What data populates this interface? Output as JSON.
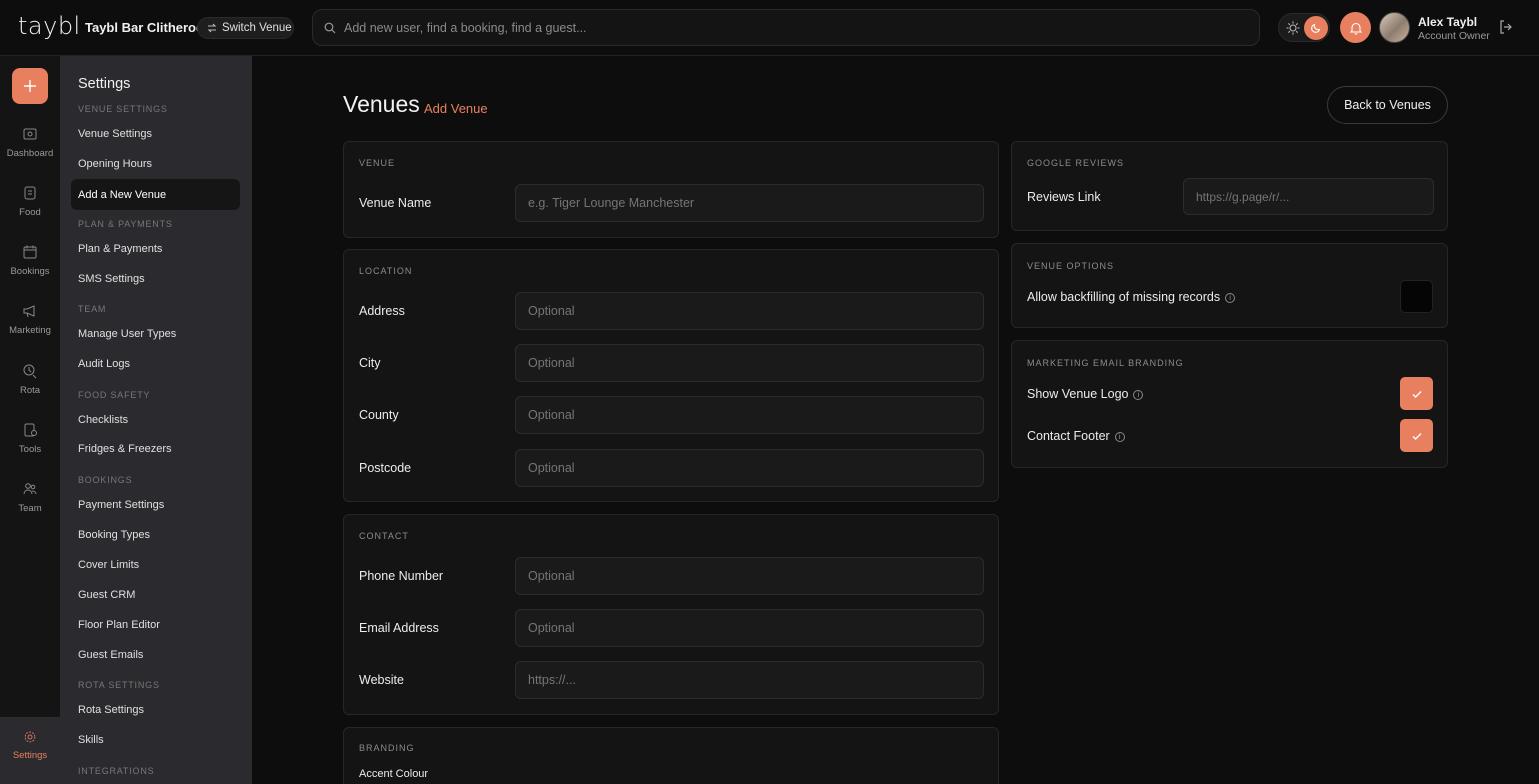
{
  "topbar": {
    "logo": "taybl",
    "venue_name": "Taybl Bar Clitheroe",
    "switch_venue": "Switch Venue",
    "search_placeholder": "Add new user, find a booking, find a guest...",
    "user_name": "Alex Taybl",
    "user_role": "Account Owner"
  },
  "rail": {
    "items": [
      {
        "label": "Dashboard",
        "icon": "dashboard-icon"
      },
      {
        "label": "Food",
        "icon": "food-icon"
      },
      {
        "label": "Bookings",
        "icon": "bookings-icon"
      },
      {
        "label": "Marketing",
        "icon": "megaphone-icon"
      },
      {
        "label": "Rota",
        "icon": "rota-icon"
      },
      {
        "label": "Tools",
        "icon": "tools-icon"
      },
      {
        "label": "Team",
        "icon": "team-icon"
      }
    ],
    "settings": "Settings"
  },
  "sidebar": {
    "title": "Settings",
    "sections": {
      "venue": "Venue Settings",
      "plan": "Plan & Payments",
      "team": "Team",
      "food": "Food Safety",
      "bookings": "Bookings",
      "rota": "Rota Settings",
      "integrations": "Integrations"
    },
    "items": {
      "venue_settings": "Venue Settings",
      "opening_hours": "Opening Hours",
      "add_venue": "Add a New Venue",
      "plan_payments": "Plan & Payments",
      "sms": "SMS Settings",
      "user_types": "Manage User Types",
      "audit": "Audit Logs",
      "checklists": "Checklists",
      "fridges": "Fridges & Freezers",
      "payment_settings": "Payment Settings",
      "booking_types": "Booking Types",
      "cover_limits": "Cover Limits",
      "guest_crm": "Guest CRM",
      "floor_plan": "Floor Plan Editor",
      "guest_emails": "Guest Emails",
      "rota_settings": "Rota Settings",
      "skills": "Skills"
    }
  },
  "main": {
    "title": "Venues",
    "add_venue": "Add Venue",
    "back_button": "Back to Venues",
    "venue_card": {
      "heading": "Venue",
      "name_label": "Venue Name",
      "name_placeholder": "e.g. Tiger Lounge Manchester"
    },
    "location_card": {
      "heading": "Location",
      "address_label": "Address",
      "city_label": "City",
      "county_label": "County",
      "postcode_label": "Postcode",
      "placeholder": "Optional"
    },
    "contact_card": {
      "heading": "Contact",
      "phone_label": "Phone Number",
      "email_label": "Email Address",
      "website_label": "Website",
      "placeholder": "Optional",
      "website_placeholder": "https://..."
    },
    "branding_card": {
      "heading": "Branding",
      "accent_label": "Accent Colour"
    },
    "google_card": {
      "heading": "Google Reviews",
      "link_label": "Reviews Link",
      "link_placeholder": "https://g.page/r/..."
    },
    "options_card": {
      "heading": "Venue Options",
      "backfill_label": "Allow backfilling of missing records",
      "backfill_checked": false
    },
    "email_card": {
      "heading": "Marketing Email Branding",
      "logo_label": "Show Venue Logo",
      "logo_checked": true,
      "footer_label": "Contact Footer",
      "footer_checked": true
    }
  },
  "colors": {
    "accent": "#e8805f",
    "background": "#0d0d0d",
    "card": "#141414",
    "sidebar": "#2b2a2e"
  }
}
